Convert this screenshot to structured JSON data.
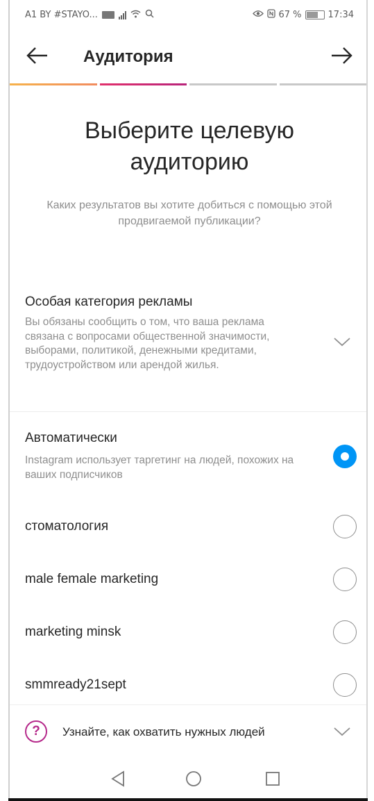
{
  "status_bar": {
    "carrier": "A1 BY #STAYO...",
    "battery_percent": "67 %",
    "time": "17:34"
  },
  "header": {
    "title": "Аудитория"
  },
  "steps": {
    "total": 4,
    "active": 2
  },
  "intro": {
    "heading": "Выберите целевую аудиторию",
    "subtitle": "Каких результатов вы хотите добиться с помощью этой продвигаемой публикации?"
  },
  "special_category": {
    "title": "Особая категория рекламы",
    "description": "Вы обязаны сообщить о том, что ваша реклама связана с вопросами общественной значимости, выборами, политикой, денежными кредитами, трудоустройством или арендой жилья."
  },
  "audience_options": [
    {
      "label": "Автоматически",
      "description": "Instagram использует таргетинг на людей, похожих на ваших подписчиков",
      "selected": true
    },
    {
      "label": "стоматология",
      "selected": false
    },
    {
      "label": "male female marketing",
      "selected": false
    },
    {
      "label": "marketing minsk",
      "selected": false
    },
    {
      "label": "smmready21sept",
      "selected": false
    }
  ],
  "learn_more": {
    "label": "Узнайте, как охватить нужных людей"
  },
  "colors": {
    "accent": "#0095f6",
    "help_icon": "#b5288a",
    "progress_first": "#f6b24b",
    "progress_second": "#e1306c"
  },
  "icons": {
    "back": "arrow-left-icon",
    "forward": "arrow-right-icon",
    "expand": "chevron-down-icon",
    "help": "question-circle-icon",
    "nav_back": "triangle-back-icon",
    "nav_home": "circle-home-icon",
    "nav_recent": "square-recent-icon"
  }
}
